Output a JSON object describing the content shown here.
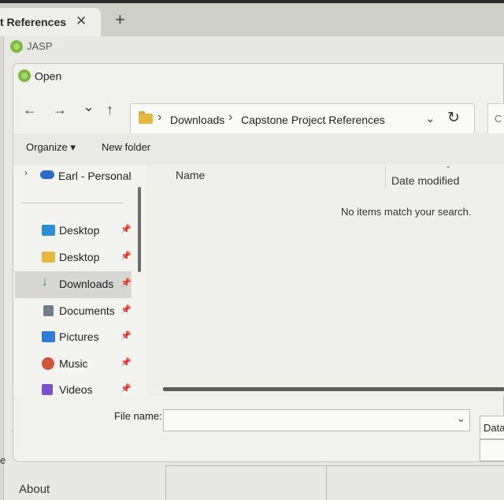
{
  "browser": {
    "tab_title": "t References",
    "tab_close_glyph": "✕",
    "new_tab_glyph": "+"
  },
  "jasp": {
    "title": "JASP",
    "side_text": "e",
    "about": "About"
  },
  "dialog": {
    "title": "Open",
    "nav": {
      "back": "←",
      "forward": "→",
      "recent": "⌄",
      "up": "↑"
    },
    "address": {
      "separator": "›",
      "crumbs": [
        "Downloads",
        "Capstone Project References"
      ],
      "chevron": "⌄",
      "refresh": "↻"
    },
    "search_stub": "C",
    "toolbar": {
      "organize": "Organize ▾",
      "new_folder": "New folder"
    },
    "nav_pane": {
      "expand_glyph": "›",
      "root": "Earl - Personal",
      "pin_glyph": "📌",
      "items": [
        {
          "label": "Desktop",
          "icon": "desktop-icon",
          "color": "#2b8fd6"
        },
        {
          "label": "Desktop",
          "icon": "folder-icon",
          "color": "#e6b83e"
        },
        {
          "label": "Downloads",
          "icon": "download-icon",
          "color": "#1e9b6a",
          "selected": true
        },
        {
          "label": "Documents",
          "icon": "documents-icon",
          "color": "#6f7d8c"
        },
        {
          "label": "Pictures",
          "icon": "pictures-icon",
          "color": "#2f7bd8"
        },
        {
          "label": "Music",
          "icon": "music-icon",
          "color": "#d4543a"
        },
        {
          "label": "Videos",
          "icon": "videos-icon",
          "color": "#7a4fcf"
        }
      ]
    },
    "file_list": {
      "columns": {
        "name": "Name",
        "date": "Date modified"
      },
      "sort_glyph": "⌄",
      "empty_message": "No items match your search."
    },
    "footer": {
      "file_name_label": "File name:",
      "file_name_value": "",
      "file_name_chevron": "⌄",
      "file_type": "Data"
    }
  }
}
